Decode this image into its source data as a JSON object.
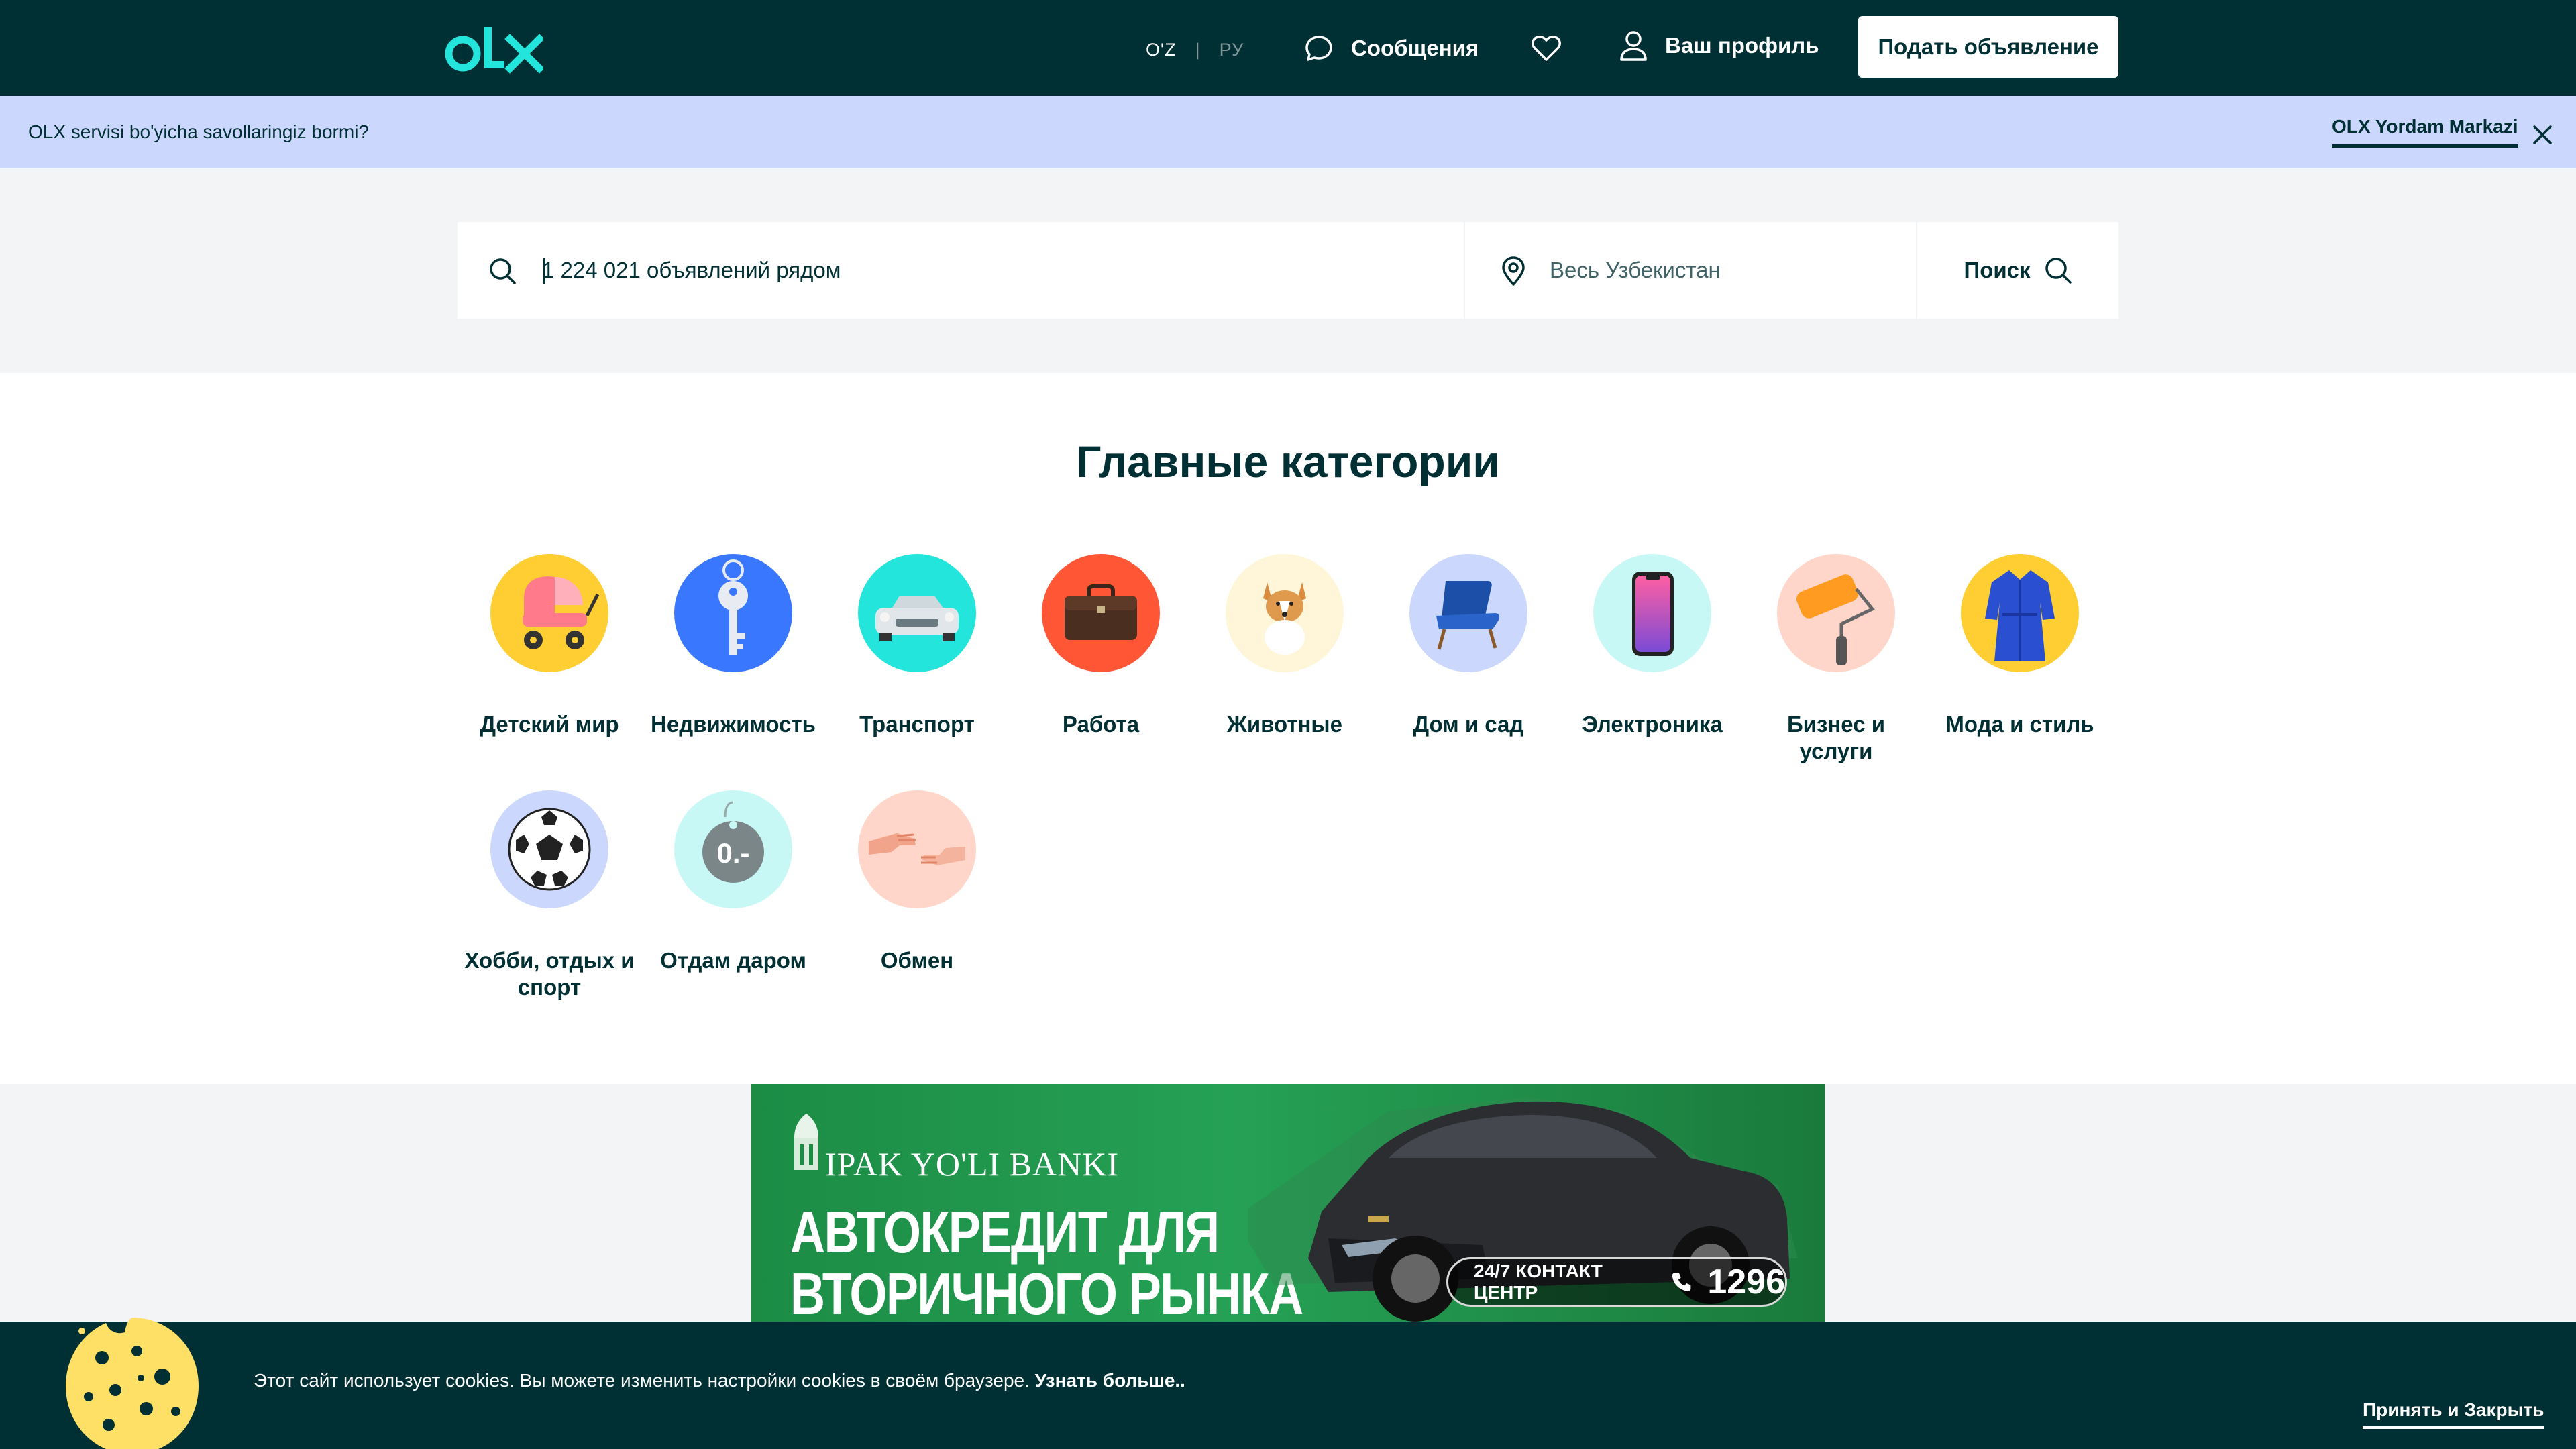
{
  "colors": {
    "header_bg": "#002f34",
    "logo_accent": "#23e5db",
    "info_bar_bg": "#cbd7fd",
    "search_band_bg": "#f2f4f5",
    "cookie_bg": "#002f34",
    "ad_green": "#25a155"
  },
  "header": {
    "logo_alt": "olx",
    "lang_active": "O'Z",
    "lang_separator": "|",
    "lang_inactive": "РУ",
    "messages_label": "Сообщения",
    "messages_icon": "chat-bubble-icon",
    "favorites_icon": "heart-icon",
    "profile_label": "Ваш профиль",
    "profile_icon": "user-icon",
    "post_ad_label": "Подать объявление"
  },
  "info_bar": {
    "text": "OLX servisi bo'yicha savollaringiz bormi?",
    "link_label": "OLX Yordam Markazi",
    "close_icon": "close-icon"
  },
  "search": {
    "query_placeholder": "1 224 021 объявлений рядом",
    "location_placeholder": "Весь Узбекистан",
    "button_label": "Поиск",
    "search_icon": "search-icon",
    "location_icon": "location-pin-icon"
  },
  "categories": {
    "title": "Главные категории",
    "items": [
      {
        "label": "Детский мир",
        "icon": "stroller-icon",
        "color": "#ffce32"
      },
      {
        "label": "Недвижимость",
        "icon": "key-icon",
        "color": "#3a77ff"
      },
      {
        "label": "Транспорт",
        "icon": "car-icon",
        "color": "#23e5db"
      },
      {
        "label": "Работа",
        "icon": "briefcase-icon",
        "color": "#ff5636"
      },
      {
        "label": "Животные",
        "icon": "dog-icon",
        "color": "#fff6d9"
      },
      {
        "label": "Дом и сад",
        "icon": "armchair-icon",
        "color": "#cbd7fd"
      },
      {
        "label": "Электроника",
        "icon": "smartphone-icon",
        "color": "#c8f8f6"
      },
      {
        "label": "Бизнес и услуги",
        "icon": "paint-roller-icon",
        "color": "#ffd6c9"
      },
      {
        "label": "Мода и стиль",
        "icon": "dress-icon",
        "color": "#ffce32"
      },
      {
        "label": "Хобби, отдых и спорт",
        "icon": "soccer-ball-icon",
        "color": "#cbd7fd"
      },
      {
        "label": "Отдам даром",
        "icon": "price-tag-icon",
        "color": "#c8f8f6",
        "tag_text": "0.-"
      },
      {
        "label": "Обмен",
        "icon": "handshake-icon",
        "color": "#ffd6c9"
      }
    ]
  },
  "ad": {
    "bank_name": "IPAK YO'LI BANKI",
    "headline_1": "АВТОКРЕДИТ ДЛЯ",
    "headline_2": "ВТОРИЧНОГО РЫНКА",
    "contact_label": "24/7 КОНТАКТ ЦЕНТР",
    "contact_number": "1296"
  },
  "cookie": {
    "text": "Этот сайт использует cookies. Вы можете изменить настройки cookies в своём браузере.",
    "learn_more": "Узнать больше..",
    "accept_label": "Принять и Закрыть"
  }
}
